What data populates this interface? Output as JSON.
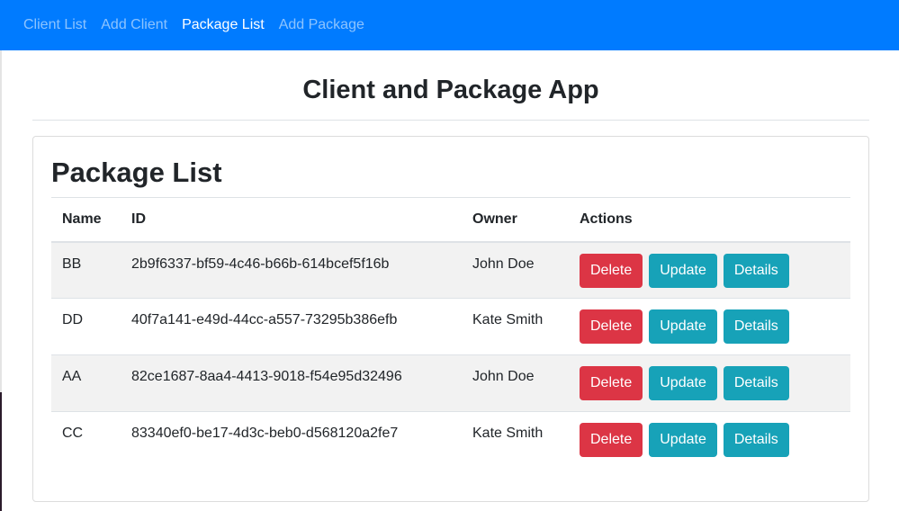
{
  "nav": {
    "items": [
      {
        "label": "Client List",
        "active": false
      },
      {
        "label": "Add Client",
        "active": false
      },
      {
        "label": "Package List",
        "active": true
      },
      {
        "label": "Add Package",
        "active": false
      }
    ]
  },
  "app_title": "Client and Package App",
  "card": {
    "title": "Package List",
    "columns": [
      "Name",
      "ID",
      "Owner",
      "Actions"
    ],
    "rows": [
      {
        "name": "BB",
        "id": "2b9f6337-bf59-4c46-b66b-614bcef5f16b",
        "owner": "John Doe"
      },
      {
        "name": "DD",
        "id": "40f7a141-e49d-44cc-a557-73295b386efb",
        "owner": "Kate Smith"
      },
      {
        "name": "AA",
        "id": "82ce1687-8aa4-4413-9018-f54e95d32496",
        "owner": "John Doe"
      },
      {
        "name": "CC",
        "id": "83340ef0-be17-4d3c-beb0-d568120a2fe7",
        "owner": "Kate Smith"
      }
    ],
    "actions": {
      "delete": "Delete",
      "update": "Update",
      "details": "Details"
    }
  },
  "colors": {
    "navbar": "#007bff",
    "danger": "#dc3545",
    "info": "#17a2b8"
  }
}
